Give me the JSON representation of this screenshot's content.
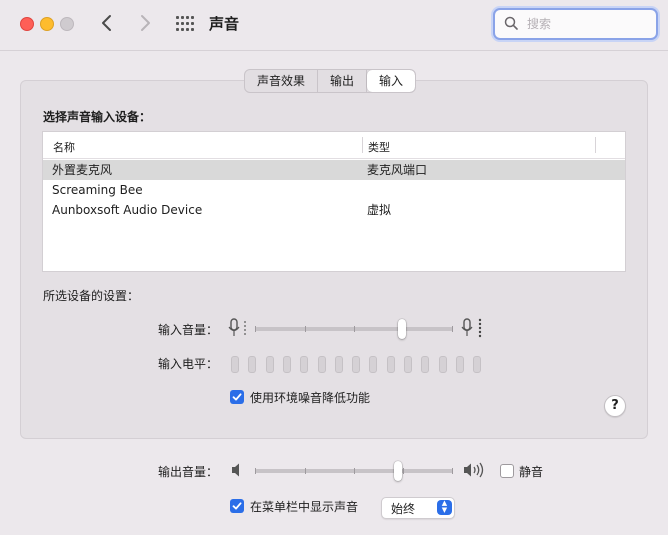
{
  "window": {
    "title": "声音"
  },
  "search": {
    "placeholder": "搜索",
    "value": ""
  },
  "tabs": [
    {
      "label": "声音效果",
      "active": false
    },
    {
      "label": "输出",
      "active": false
    },
    {
      "label": "输入",
      "active": true
    }
  ],
  "input_section": {
    "heading": "选择声音输入设备：",
    "columns": [
      "名称",
      "类型"
    ],
    "devices": [
      {
        "name": "外置麦克风",
        "type": "麦克风端口",
        "selected": true
      },
      {
        "name": "Screaming Bee",
        "type": "",
        "selected": false
      },
      {
        "name": "Aunboxsoft Audio Device",
        "type": "虚拟",
        "selected": false
      }
    ],
    "settings_label": "所选设备的设置：",
    "input_volume_label": "输入音量：",
    "input_volume": 0.74,
    "input_level_label": "输入电平：",
    "input_level_segments": 15,
    "input_level_active": 0,
    "noise_reduction_label": "使用环境噪音降低功能",
    "noise_reduction_checked": true,
    "help_label": "?"
  },
  "output": {
    "volume_label": "输出音量：",
    "volume": 0.72,
    "mute_label": "静音",
    "mute_checked": false,
    "menubar_label": "在菜单栏中显示声音",
    "menubar_checked": true,
    "menubar_option": "始终"
  },
  "colors": {
    "accent": "#2b6ee8",
    "selected_row": "#d9d9d9",
    "close": "#fe5f57",
    "minimize": "#febc2e"
  }
}
